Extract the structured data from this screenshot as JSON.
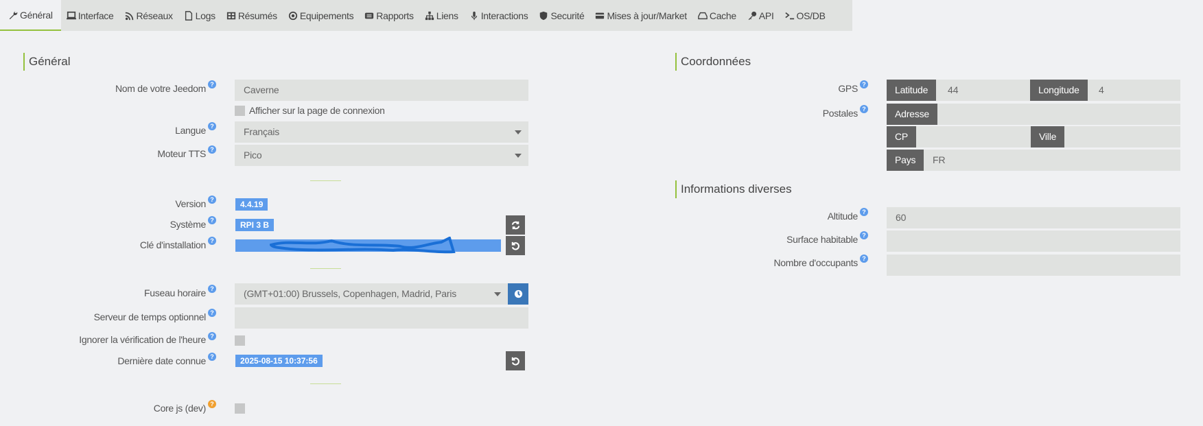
{
  "tabs": [
    {
      "label": "Général",
      "icon": "wrench-icon",
      "active": true
    },
    {
      "label": "Interface",
      "icon": "laptop-icon"
    },
    {
      "label": "Réseaux",
      "icon": "rss-icon"
    },
    {
      "label": "Logs",
      "icon": "file-icon"
    },
    {
      "label": "Résumés",
      "icon": "table-icon"
    },
    {
      "label": "Equipements",
      "icon": "cogs-icon"
    },
    {
      "label": "Rapports",
      "icon": "list-icon"
    },
    {
      "label": "Liens",
      "icon": "sitemap-icon"
    },
    {
      "label": "Interactions",
      "icon": "microphone-icon"
    },
    {
      "label": "Securité",
      "icon": "shield-icon"
    },
    {
      "label": "Mises à jour/Market",
      "icon": "credit-card-icon"
    },
    {
      "label": "Cache",
      "icon": "hdd-icon"
    },
    {
      "label": "API",
      "icon": "key-icon"
    },
    {
      "label": "OS/DB",
      "icon": "terminal-icon"
    }
  ],
  "general": {
    "title": "Général",
    "name_label": "Nom de votre Jeedom",
    "name_value": "Caverne",
    "show_login_label": "Afficher sur la page de connexion",
    "lang_label": "Langue",
    "lang_value": "Français",
    "tts_label": "Moteur TTS",
    "tts_value": "Pico",
    "version_label": "Version",
    "version_value": "4.4.19",
    "system_label": "Système",
    "system_value": "RPI 3 B",
    "key_label": "Clé d'installation",
    "tz_label": "Fuseau horaire",
    "tz_value": "(GMT+01:00) Brussels, Copenhagen, Madrid, Paris",
    "ntp_label": "Serveur de temps optionnel",
    "ntp_value": "",
    "ignore_time_label": "Ignorer la vérification de l'heure",
    "last_date_label": "Dernière date connue",
    "last_date_value": "2025-08-15 10:37:56",
    "corejs_label": "Core js (dev)"
  },
  "coords": {
    "title": "Coordonnées",
    "gps_label": "GPS",
    "lat_label": "Latitude",
    "lat_value": "44",
    "lon_label": "Longitude",
    "lon_value": "4",
    "postal_label": "Postales",
    "address_label": "Adresse",
    "cp_label": "CP",
    "city_label": "Ville",
    "country_label": "Pays",
    "country_value": "FR"
  },
  "misc": {
    "title": "Informations diverses",
    "altitude_label": "Altitude",
    "altitude_value": "60",
    "surface_label": "Surface habitable",
    "occupants_label": "Nombre d'occupants"
  },
  "colors": {
    "accent": "#94c13d",
    "badge": "#5d9cec",
    "button": "#616161",
    "tz_button": "#3a77b8"
  }
}
